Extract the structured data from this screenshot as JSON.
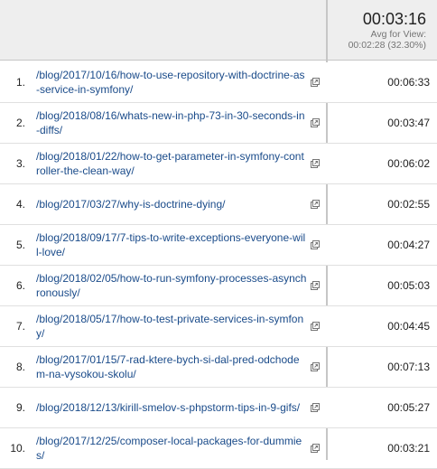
{
  "summary": {
    "value": "00:03:16",
    "label": "Avg for View:",
    "detail": "00:02:28 (32.30%)"
  },
  "colors": {
    "link": "#1a4b8a",
    "header_bg": "#eeeeee",
    "divider": "#c6c6c6"
  },
  "icons": {
    "row_action": "open-in-new-window-icon"
  },
  "rows": [
    {
      "index": "1.",
      "path": "/blog/2017/10/16/how-to-use-repository-with-doctrine-as-service-in-symfony/",
      "time": "00:06:33"
    },
    {
      "index": "2.",
      "path": "/blog/2018/08/16/whats-new-in-php-73-in-30-seconds-in-diffs/",
      "time": "00:03:47"
    },
    {
      "index": "3.",
      "path": "/blog/2018/01/22/how-to-get-parameter-in-symfony-controller-the-clean-way/",
      "time": "00:06:02"
    },
    {
      "index": "4.",
      "path": "/blog/2017/03/27/why-is-doctrine-dying/",
      "time": "00:02:55"
    },
    {
      "index": "5.",
      "path": "/blog/2018/09/17/7-tips-to-write-exceptions-everyone-will-love/",
      "time": "00:04:27"
    },
    {
      "index": "6.",
      "path": "/blog/2018/02/05/how-to-run-symfony-processes-asynchronously/",
      "time": "00:05:03"
    },
    {
      "index": "7.",
      "path": "/blog/2018/05/17/how-to-test-private-services-in-symfony/",
      "time": "00:04:45"
    },
    {
      "index": "8.",
      "path": "/blog/2017/01/15/7-rad-ktere-bych-si-dal-pred-odchodem-na-vysokou-skolu/",
      "time": "00:07:13"
    },
    {
      "index": "9.",
      "path": "/blog/2018/12/13/kirill-smelov-s-phpstorm-tips-in-9-gifs/",
      "time": "00:05:27"
    },
    {
      "index": "10.",
      "path": "/blog/2017/12/25/composer-local-packages-for-dummies/",
      "time": "00:03:21"
    }
  ]
}
